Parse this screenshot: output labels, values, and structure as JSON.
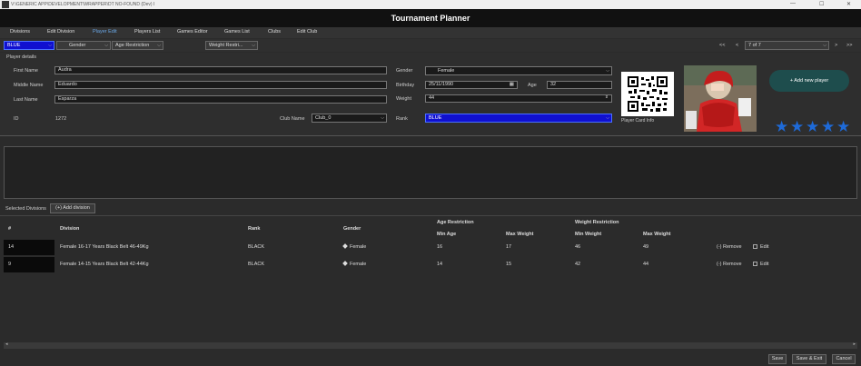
{
  "window": {
    "title": "V:\\GENERIC APP\\DEVELOPMENT\\WRAPPER\\DT NO-FOUND (Dev) I",
    "header": "Tournament Planner"
  },
  "tabs": [
    "Divisions",
    "Edit Division",
    "Player Edit",
    "Players List",
    "Games Editor",
    "Games List",
    "Clubs",
    "Edit Club"
  ],
  "filters": {
    "rank": "BLUE",
    "gender": "Gender",
    "age": "Age Restriction",
    "weight": "Weight Restri..."
  },
  "pager": {
    "first": "<<",
    "prev": "<",
    "page": "7 of 7",
    "next": ">",
    "last": ">>"
  },
  "player": {
    "section_title": "Player details",
    "first_name_label": "First Name",
    "first_name": "Audra",
    "middle_name_label": "Middle Name",
    "middle_name": "Eduardo",
    "last_name_label": "Last Name",
    "last_name": "Esparza",
    "id_label": "ID",
    "id": "1272",
    "club_label": "Club Name",
    "club": "Club_0",
    "gender_label": "Gender",
    "gender": "Female",
    "birthday_label": "Birthday",
    "birthday": "25/11/1990",
    "age_label": "Age",
    "age": "32",
    "weight_label": "Weight",
    "weight": "44",
    "rank_label": "Rank",
    "rank": "BLUE",
    "card_label": "Player Card Info",
    "add_button": "+ Add new player",
    "stars": 5
  },
  "selected": {
    "label": "Selected Divisions",
    "add_button": "(+) Add division"
  },
  "grid": {
    "headers": {
      "num": "#",
      "division": "Division",
      "rank": "Rank",
      "gender": "Gender",
      "age_group": "Age Restriction",
      "min_age": "Min Age",
      "max_age": "Max Weight",
      "weight_group": "Weight Restriction",
      "min_weight": "Min Weight",
      "max_weight": "Max Weight"
    },
    "rows": [
      {
        "id": "14",
        "division": "Female 16-17 Years Black Belt 46-49Kg",
        "rank": "BLACK",
        "gender": "Female",
        "min_age": "16",
        "max_age": "17",
        "min_weight": "46",
        "max_weight": "49",
        "remove": "(-) Remove",
        "edit": "Edit"
      },
      {
        "id": "9",
        "division": "Female 14-15 Years Black Belt 42-44Kg",
        "rank": "BLACK",
        "gender": "Female",
        "min_age": "14",
        "max_age": "15",
        "min_weight": "42",
        "max_weight": "44",
        "remove": "(-) Remove",
        "edit": "Edit"
      }
    ]
  },
  "footer": {
    "save": "Save",
    "save_exit": "Save & Exit",
    "cancel": "Cancel"
  },
  "colors": {
    "accent": "#1e6ad8",
    "rank_blue": "#1010d0",
    "add_btn": "#1e4d4d"
  }
}
